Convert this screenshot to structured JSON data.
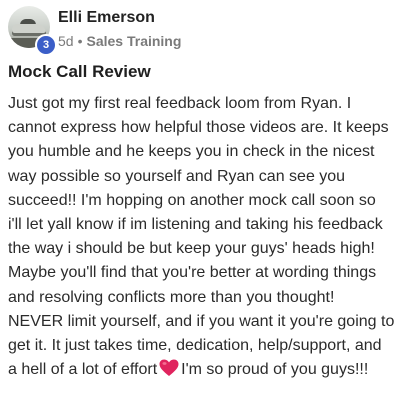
{
  "post": {
    "author": {
      "name": "Elli Emerson",
      "level": "3"
    },
    "meta": {
      "time": "5d",
      "separator": "•",
      "category": "Sales Training"
    },
    "title": "Mock Call Review",
    "body_lines": [
      "Just got my first real feedback loom from Ryan. I",
      "cannot express how helpful those videos are. It keeps",
      "you humble and he keeps you in check in the nicest",
      "way possible so yourself and Ryan can see you",
      "succeed!! I'm hopping on another mock call soon so",
      "i'll let yall know if im listening and taking his feedback",
      "the way i should be but keep your guys' heads high!",
      "Maybe you'll find that you're better at wording things",
      "and resolving conflicts more than you thought!",
      "NEVER limit yourself, and if you want it you're going to",
      "get it. It just takes time, dedication, help/support, and"
    ],
    "last_line_before_emoji": "a hell of a lot of effort",
    "emoji_icon": "red-heart-icon",
    "last_line_after_emoji": "I'm so proud of you guys!!!",
    "colors": {
      "badge": "#3b5ec8",
      "heart": "#e0245e",
      "meta_text": "#7a7a7a"
    }
  }
}
